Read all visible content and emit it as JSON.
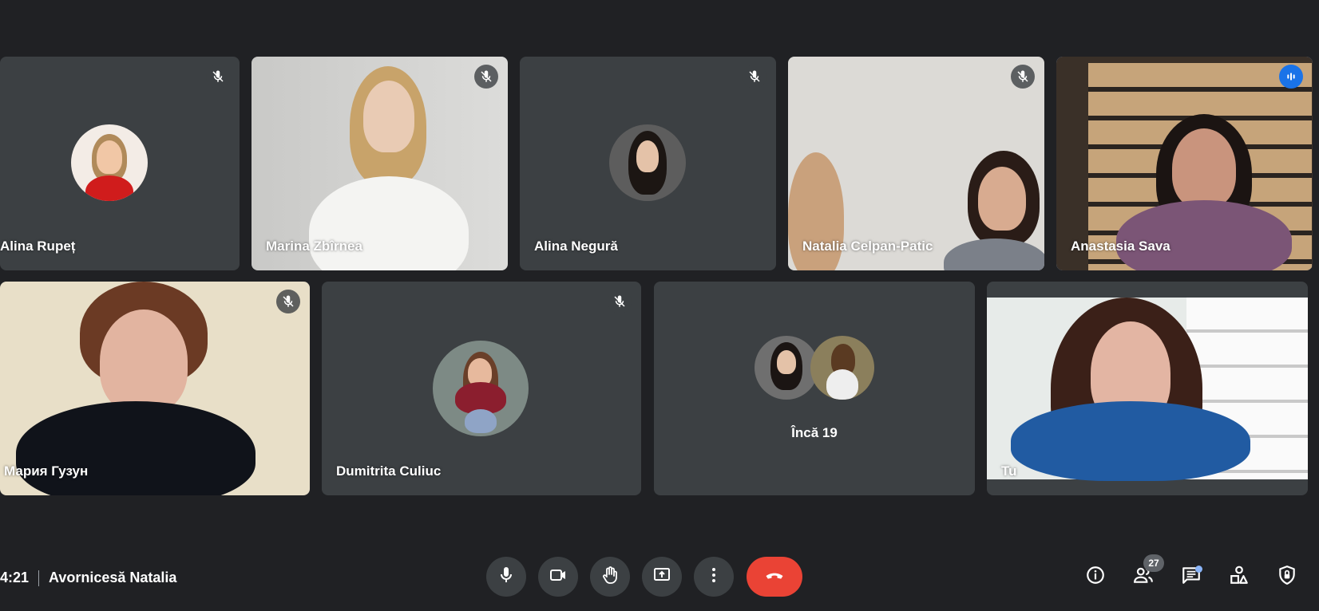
{
  "participants": [
    {
      "name": "Alina Rupeț",
      "muted": true
    },
    {
      "name": "Marina Zbîrnea",
      "muted": true
    },
    {
      "name": "Alina Negură",
      "muted": true
    },
    {
      "name": "Natalia Celpan-Patic",
      "muted": true
    },
    {
      "name": "Anastasia Sava",
      "muted": false,
      "speaking": true
    },
    {
      "name": "Мария Гузун",
      "muted": true
    },
    {
      "name": "Dumitrita Culiuc",
      "muted": true
    },
    {
      "name": "Tu",
      "muted": false
    }
  ],
  "more_tile": {
    "label": "Încă 19"
  },
  "meeting": {
    "time": "4:21",
    "title": "Avornicesă Natalia"
  },
  "controls": {
    "mic": "microphone-icon",
    "camera": "camera-icon",
    "hand": "raise-hand-icon",
    "present": "present-screen-icon",
    "more": "more-options-icon",
    "end": "end-call-icon"
  },
  "right_panel": {
    "info": "info-icon",
    "people": "people-icon",
    "people_count": "27",
    "chat": "chat-icon",
    "activities": "activities-icon",
    "host": "host-controls-icon"
  },
  "colors": {
    "background": "#202124",
    "tile": "#3c4043",
    "accent": "#8ab4f8",
    "end_call": "#ea4335"
  }
}
